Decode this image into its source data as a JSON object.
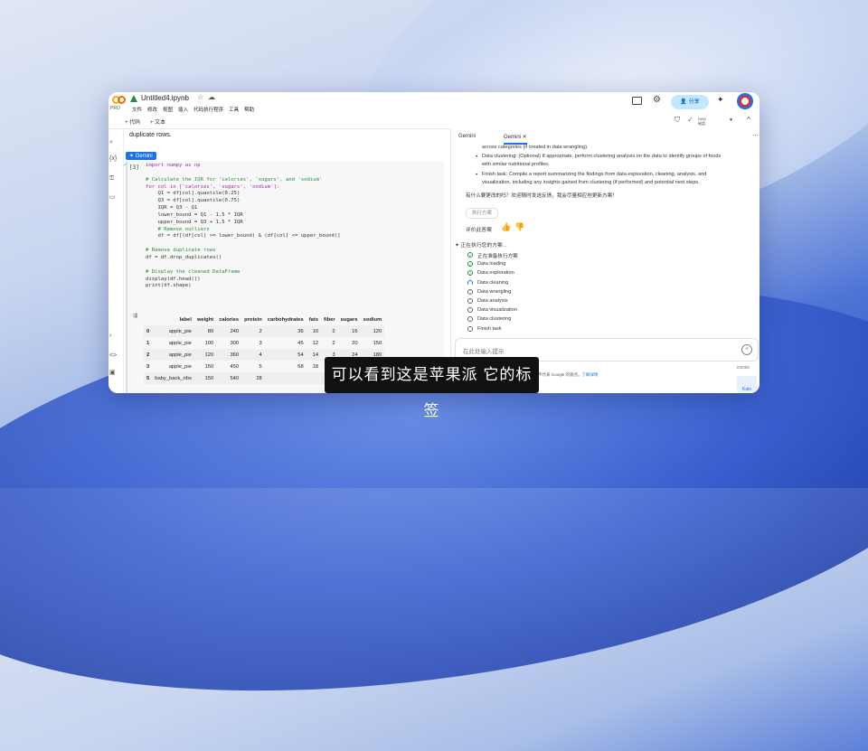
{
  "app": {
    "title": "Untitled4.ipynb",
    "pro_label": "PRO",
    "menu": [
      "文件",
      "修改",
      "视图",
      "插入",
      "代码执行程序",
      "工具",
      "帮助"
    ],
    "share_label": "分享"
  },
  "toolbar": {
    "add_code": "+ 代码",
    "add_text": "+ 文本",
    "ram_label": "RAM",
    "disk_label": "磁盘"
  },
  "notebook": {
    "intro_text": "duplicate rows.",
    "gemini_chip": "✦ Gemini",
    "exec_count": "[3]",
    "code_lines": [
      "import numpy as np",
      "",
      "# Calculate the IQR for 'calories', 'sugars', and 'sodium'",
      "for col in ['calories', 'sugars', 'sodium']:",
      "    Q1 = df[col].quantile(0.25)",
      "    Q3 = df[col].quantile(0.75)",
      "    IQR = Q3 - Q1",
      "    lower_bound = Q1 - 1.5 * IQR",
      "    upper_bound = Q3 + 1.5 * IQR",
      "    # Remove outliers",
      "    df = df[(df[col] >= lower_bound) & (df[col] <= upper_bound)]",
      "",
      "# Remove duplicate rows",
      "df = df.drop_duplicates()",
      "",
      "# Display the cleaned DataFrame",
      "display(df.head())",
      "print(df.shape)"
    ],
    "table": {
      "columns": [
        "",
        "label",
        "weight",
        "calories",
        "protein",
        "carbohydrates",
        "fats",
        "fiber",
        "sugars",
        "sodium"
      ],
      "rows": [
        [
          "0",
          "apple_pie",
          "80",
          "240",
          "2",
          "36",
          "10",
          "2",
          "16",
          "120"
        ],
        [
          "1",
          "apple_pie",
          "100",
          "300",
          "3",
          "45",
          "12",
          "2",
          "20",
          "150"
        ],
        [
          "2",
          "apple_pie",
          "120",
          "360",
          "4",
          "54",
          "14",
          "3",
          "24",
          "180"
        ],
        [
          "3",
          "apple_pie",
          "150",
          "450",
          "5",
          "68",
          "18",
          "4",
          "30",
          "225"
        ],
        [
          "5",
          "baby_back_ribs",
          "150",
          "540",
          "28",
          "",
          "",
          "",
          "",
          ""
        ]
      ]
    }
  },
  "gemini": {
    "tab_inactive": "Gemini",
    "tab_active": "Gemini",
    "lines": [
      "across categories (if created in data wrangling).",
      "Data clustering: (Optional) If appropriate, perform clustering analysis on the data to identify groups of foods",
      "with similar nutritional profiles.",
      "Finish task: Compile a report summarizing the findings from data exploration, cleaning, analysis, and",
      "visualization, including any insights gained from clustering (if performed) and potential next steps.",
      "有什么要更改的吗？欢迎随时发送反馈，我会尽量相应地更新方案！"
    ],
    "execute_pill": "执行方案",
    "rate_label": "评价此答案",
    "plan_heading": "正在执行您的方案...",
    "steps": [
      {
        "label": "正在准备执行方案",
        "state": "done"
      },
      {
        "label": "Data loading",
        "state": "done"
      },
      {
        "label": "Data exploration",
        "state": "done"
      },
      {
        "label": "Data cleaning",
        "state": "running"
      },
      {
        "label": "Data wrangling",
        "state": "pending"
      },
      {
        "label": "Data analysis",
        "state": "pending"
      },
      {
        "label": "Data visualization",
        "state": "pending"
      },
      {
        "label": "Data clustering",
        "state": "pending"
      },
      {
        "label": "Finish task",
        "state": "pending"
      }
    ],
    "input_placeholder": "在此处输入提示",
    "counter": "0/2000",
    "disclaimer": "不代表 Google 的观点。",
    "disclaimer_link": "了解详情"
  },
  "subtitle": "可以看到这是苹果派 它的标签"
}
